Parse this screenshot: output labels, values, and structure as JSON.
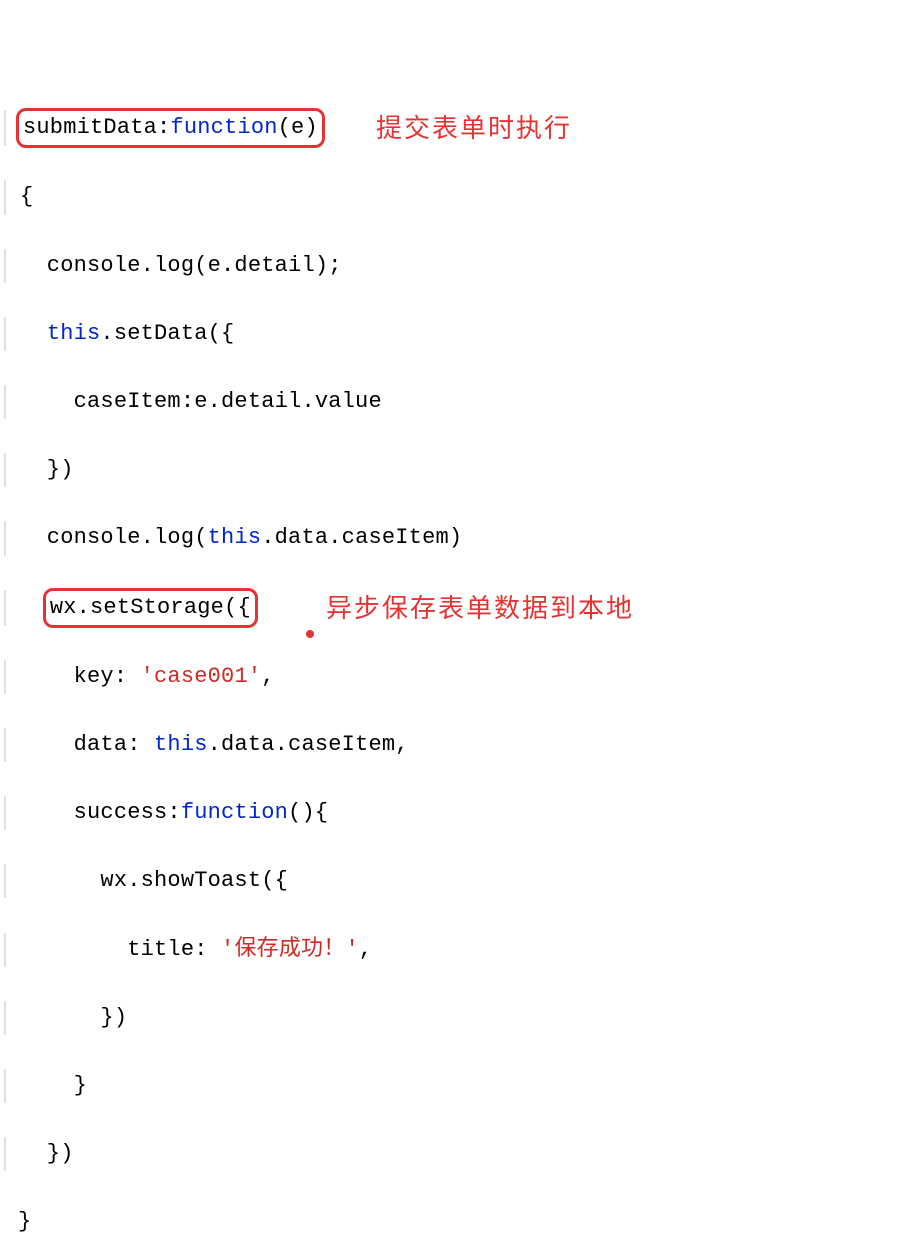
{
  "code": {
    "l1": {
      "p1": "submitData",
      "p2": ":",
      "fn": "function",
      "p3": "(e)"
    },
    "l2": "{",
    "l3": {
      "pre": "  console.log(e.detail);"
    },
    "l4": {
      "indent": "  ",
      "this": "this",
      "rest": ".setData({"
    },
    "l5": "    caseItem:e.detail.value",
    "l6": "  })",
    "l7": {
      "indent": "  console.log(",
      "this": "this",
      "rest": ".data.caseItem)"
    },
    "l8": {
      "indent": "  ",
      "box": "wx.setStorage({"
    },
    "l9": {
      "indent": "    key: ",
      "str": "'case001'",
      "rest": ","
    },
    "l10": {
      "indent": "    data: ",
      "this": "this",
      "rest": ".data.caseItem,"
    },
    "l11": {
      "indent": "    success:",
      "fn": "function",
      "rest": "(){"
    },
    "l12": "      wx.showToast({",
    "l13": {
      "indent": "        title: ",
      "str": "'保存成功！'",
      "rest": ","
    },
    "l14": "      })",
    "l15": "    }",
    "l16": "  })",
    "l17": "}"
  },
  "annotations": {
    "a1": "提交表单时执行",
    "a2": "异步保存表单数据到本地"
  }
}
